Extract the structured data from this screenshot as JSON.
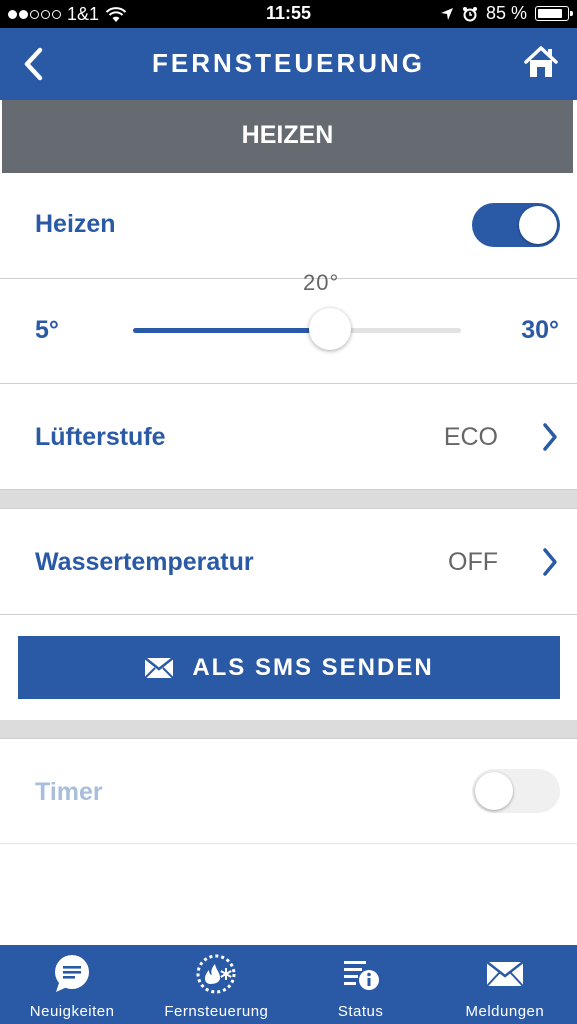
{
  "status_bar": {
    "carrier": "1&1",
    "time": "11:55",
    "battery": "85 %",
    "signal_dots": [
      true,
      true,
      false,
      false,
      false
    ]
  },
  "navbar": {
    "title": "FERNSTEUERUNG",
    "back_icon": "chevron-left-icon",
    "home_icon": "home-icon"
  },
  "section": {
    "title": "HEIZEN"
  },
  "heizen": {
    "label": "Heizen",
    "enabled": true
  },
  "temperature": {
    "min_label": "5°",
    "max_label": "30°",
    "value_label": "20°",
    "min": 5,
    "max": 30,
    "value": 20
  },
  "luefter": {
    "label": "Lüfterstufe",
    "value": "ECO"
  },
  "wasser": {
    "label": "Wassertemperatur",
    "value": "OFF"
  },
  "sms": {
    "label": "ALS SMS SENDEN",
    "icon": "envelope-icon"
  },
  "timer": {
    "label": "Timer",
    "enabled": false
  },
  "tabs": [
    {
      "label": "Neuigkeiten",
      "icon": "chat-bubble-icon"
    },
    {
      "label": "Fernsteuerung",
      "icon": "remote-control-icon"
    },
    {
      "label": "Status",
      "icon": "status-list-icon"
    },
    {
      "label": "Meldungen",
      "icon": "envelope-icon"
    }
  ],
  "colors": {
    "primary": "#2a5aa6",
    "header_gray": "#666b72",
    "separator": "#dcdcdc",
    "disabled_label": "#a9bedb"
  }
}
